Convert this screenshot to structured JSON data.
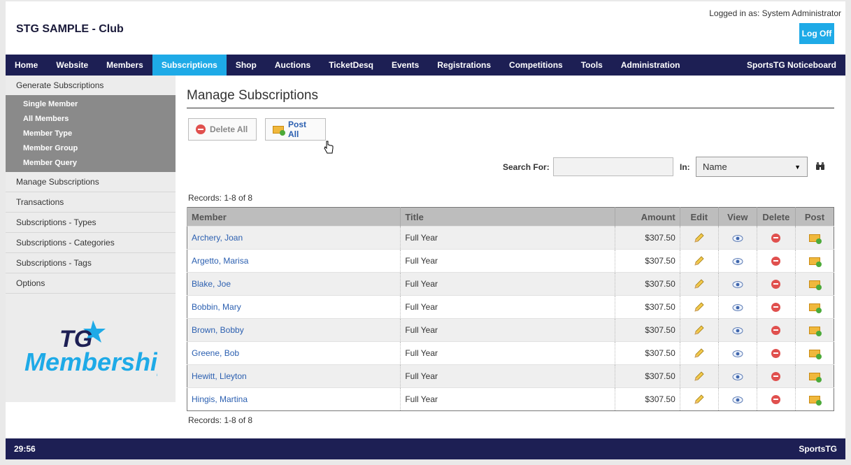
{
  "header": {
    "club_title": "STG SAMPLE - Club",
    "logged_in": "Logged in as: System Administrator",
    "logoff_label": "Log Off"
  },
  "nav": {
    "items": [
      "Home",
      "Website",
      "Members",
      "Subscriptions",
      "Shop",
      "Auctions",
      "TicketDesq",
      "Events",
      "Registrations",
      "Competitions",
      "Tools",
      "Administration"
    ],
    "active": "Subscriptions",
    "right_item": "SportsTG Noticeboard"
  },
  "sidebar": {
    "generate_label": "Generate Subscriptions",
    "sub_items": [
      "Single Member",
      "All Members",
      "Member Type",
      "Member Group",
      "Member Query"
    ],
    "items": [
      "Manage Subscriptions",
      "Transactions",
      "Subscriptions - Types",
      "Subscriptions - Categories",
      "Subscriptions - Tags",
      "Options"
    ],
    "logo_line1": "TG",
    "logo_line2": "Membership"
  },
  "main": {
    "title": "Manage Subscriptions",
    "delete_all_label": "Delete All",
    "post_all_label": "Post All",
    "search_label": "Search For:",
    "search_value": "",
    "in_label": "In:",
    "in_selected": "Name",
    "records_top": "Records: 1-8 of 8",
    "records_bottom": "Records: 1-8 of 8",
    "columns": [
      "Member",
      "Title",
      "Amount",
      "Edit",
      "View",
      "Delete",
      "Post"
    ],
    "rows": [
      {
        "member": "Archery, Joan",
        "title": "Full Year",
        "amount": "$307.50"
      },
      {
        "member": "Argetto, Marisa",
        "title": "Full Year",
        "amount": "$307.50"
      },
      {
        "member": "Blake, Joe",
        "title": "Full Year",
        "amount": "$307.50"
      },
      {
        "member": "Bobbin, Mary",
        "title": "Full Year",
        "amount": "$307.50"
      },
      {
        "member": "Brown, Bobby",
        "title": "Full Year",
        "amount": "$307.50"
      },
      {
        "member": "Greene, Bob",
        "title": "Full Year",
        "amount": "$307.50"
      },
      {
        "member": "Hewitt, Lleyton",
        "title": "Full Year",
        "amount": "$307.50"
      },
      {
        "member": "Hingis, Martina",
        "title": "Full Year",
        "amount": "$307.50"
      }
    ]
  },
  "footer": {
    "timer": "29:56",
    "brand": "SportsTG"
  },
  "colors": {
    "nav_bg": "#1d1f54",
    "accent": "#1eaae7",
    "link": "#2b5fb0"
  }
}
